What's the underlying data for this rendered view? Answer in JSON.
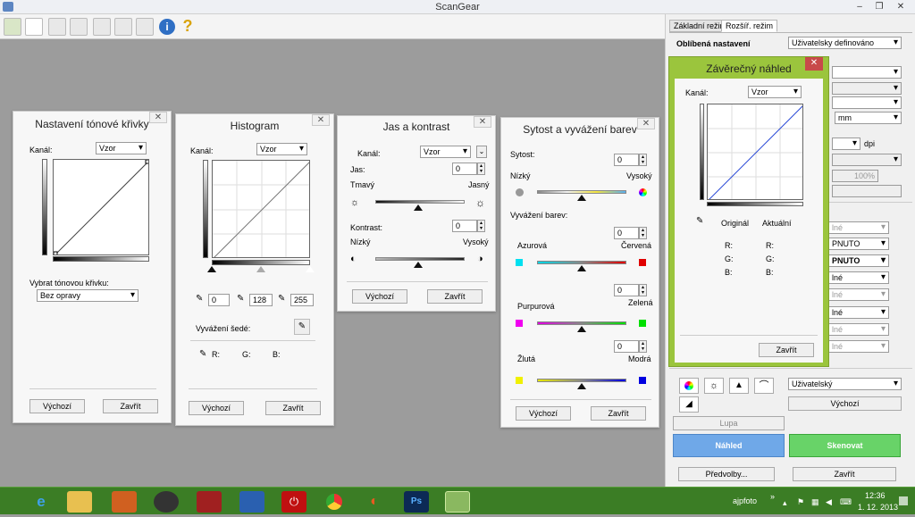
{
  "app": {
    "title": "ScanGear"
  },
  "toolbar": {
    "icons": [
      "scan-icon",
      "new-icon",
      "print-icon",
      "save-icon",
      "crop-icon",
      "select-all-icon",
      "grid-icon",
      "info-icon",
      "help-icon"
    ]
  },
  "tone_curve": {
    "title": "Nastavení tónové křivky",
    "channel_label": "Kanál:",
    "channel_value": "Vzor",
    "select_curve_label": "Vybrat tónovou křivku:",
    "curve_value": "Bez opravy",
    "default_btn": "Výchozí",
    "close_btn": "Zavřít"
  },
  "histogram": {
    "title": "Histogram",
    "channel_label": "Kanál:",
    "channel_value": "Vzor",
    "shadow": "0",
    "mid": "128",
    "highlight": "255",
    "gray_balance": "Vyvážení šedé:",
    "r_label": "R:",
    "g_label": "G:",
    "b_label": "B:",
    "default_btn": "Výchozí",
    "close_btn": "Zavřít"
  },
  "brightness": {
    "title": "Jas a kontrast",
    "channel_label": "Kanál:",
    "channel_value": "Vzor",
    "jas_label": "Jas:",
    "jas_value": "0",
    "dark": "Tmavý",
    "light": "Jasný",
    "contrast_label": "Kontrast:",
    "contrast_value": "0",
    "low": "Nízký",
    "high": "Vysoký",
    "default_btn": "Výchozí",
    "close_btn": "Zavřít"
  },
  "saturation": {
    "title": "Sytost a vyvážení barev",
    "sat_label": "Sytost:",
    "sat_value": "0",
    "low": "Nízký",
    "high": "Vysoký",
    "balance_label": "Vyvážení barev:",
    "cyan": "Azurová",
    "red": "Červená",
    "cr_value": "0",
    "magenta": "Purpurová",
    "green": "Zelená",
    "mg_value": "0",
    "yellow": "Žlutá",
    "blue": "Modrá",
    "yb_value": "0",
    "default_btn": "Výchozí",
    "close_btn": "Zavřít"
  },
  "final_preview": {
    "title": "Závěrečný náhled",
    "channel_label": "Kanál:",
    "channel_value": "Vzor",
    "original": "Originál",
    "current": "Aktuální",
    "r": "R:",
    "g": "G:",
    "b": "B:",
    "close_btn": "Zavřít"
  },
  "panel": {
    "tab_basic": "Základní režim",
    "tab_advanced": "Rozšíř. režim",
    "fav_label": "Oblíbená nastavení",
    "fav_value": "Uživatelsky definováno",
    "unit_value": "mm",
    "dpi_label": "dpi",
    "zoom_value": "100%",
    "partial_1": "lné",
    "partial_2": "PNUTO",
    "partial_3": "PNUTO",
    "partial_4": "lné",
    "partial_5": "lné",
    "partial_6": "lné",
    "partial_7": "lné",
    "partial_8": "lné",
    "user_value": "Uživatelský",
    "default_btn": "Výchozí",
    "zoom_btn": "Lupa",
    "preview_btn": "Náhled",
    "scan_btn": "Skenovat",
    "prefs_btn": "Předvolby...",
    "close_btn": "Zavřít"
  },
  "taskbar": {
    "user": "ajpfoto",
    "time": "12:36",
    "date": "1. 12. 2013"
  },
  "colors": {
    "preview_blue": "#6fa8e8",
    "scan_green": "#68d368",
    "taskbar_green": "#3b7d25",
    "dialog_green": "#9bc53d"
  }
}
